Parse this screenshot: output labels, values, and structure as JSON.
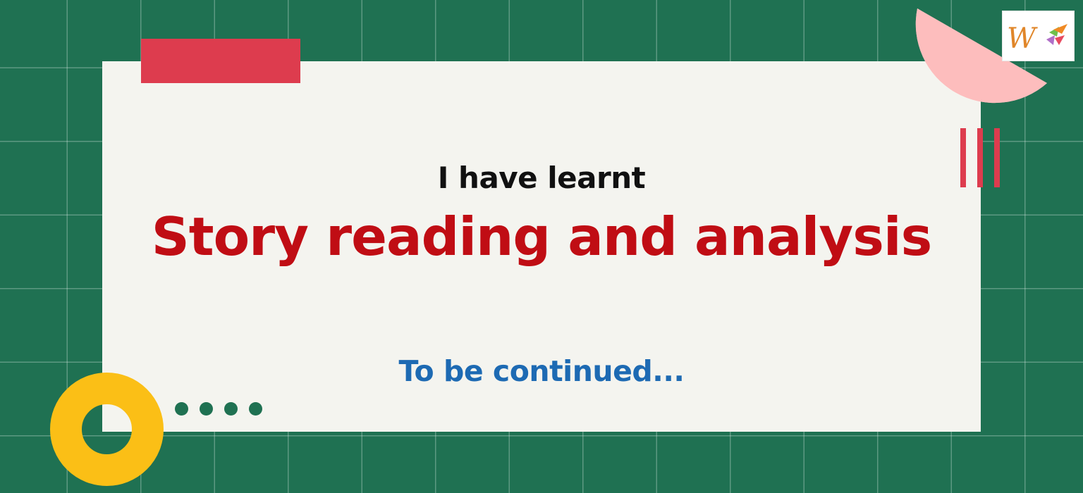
{
  "slide": {
    "subtitle": "I have learnt",
    "title": "Story reading and analysis",
    "continued": "To be continued..."
  },
  "logo": {
    "icon": "w-logo-icon"
  },
  "colors": {
    "background": "#1f7152",
    "card": "#f4f4ef",
    "title": "#c00d14",
    "subtitle": "#111111",
    "continued": "#1d6ab3",
    "red_bar": "#dd3c4e",
    "ring": "#fbbf16",
    "pink_circle": "#fdbdbd"
  }
}
